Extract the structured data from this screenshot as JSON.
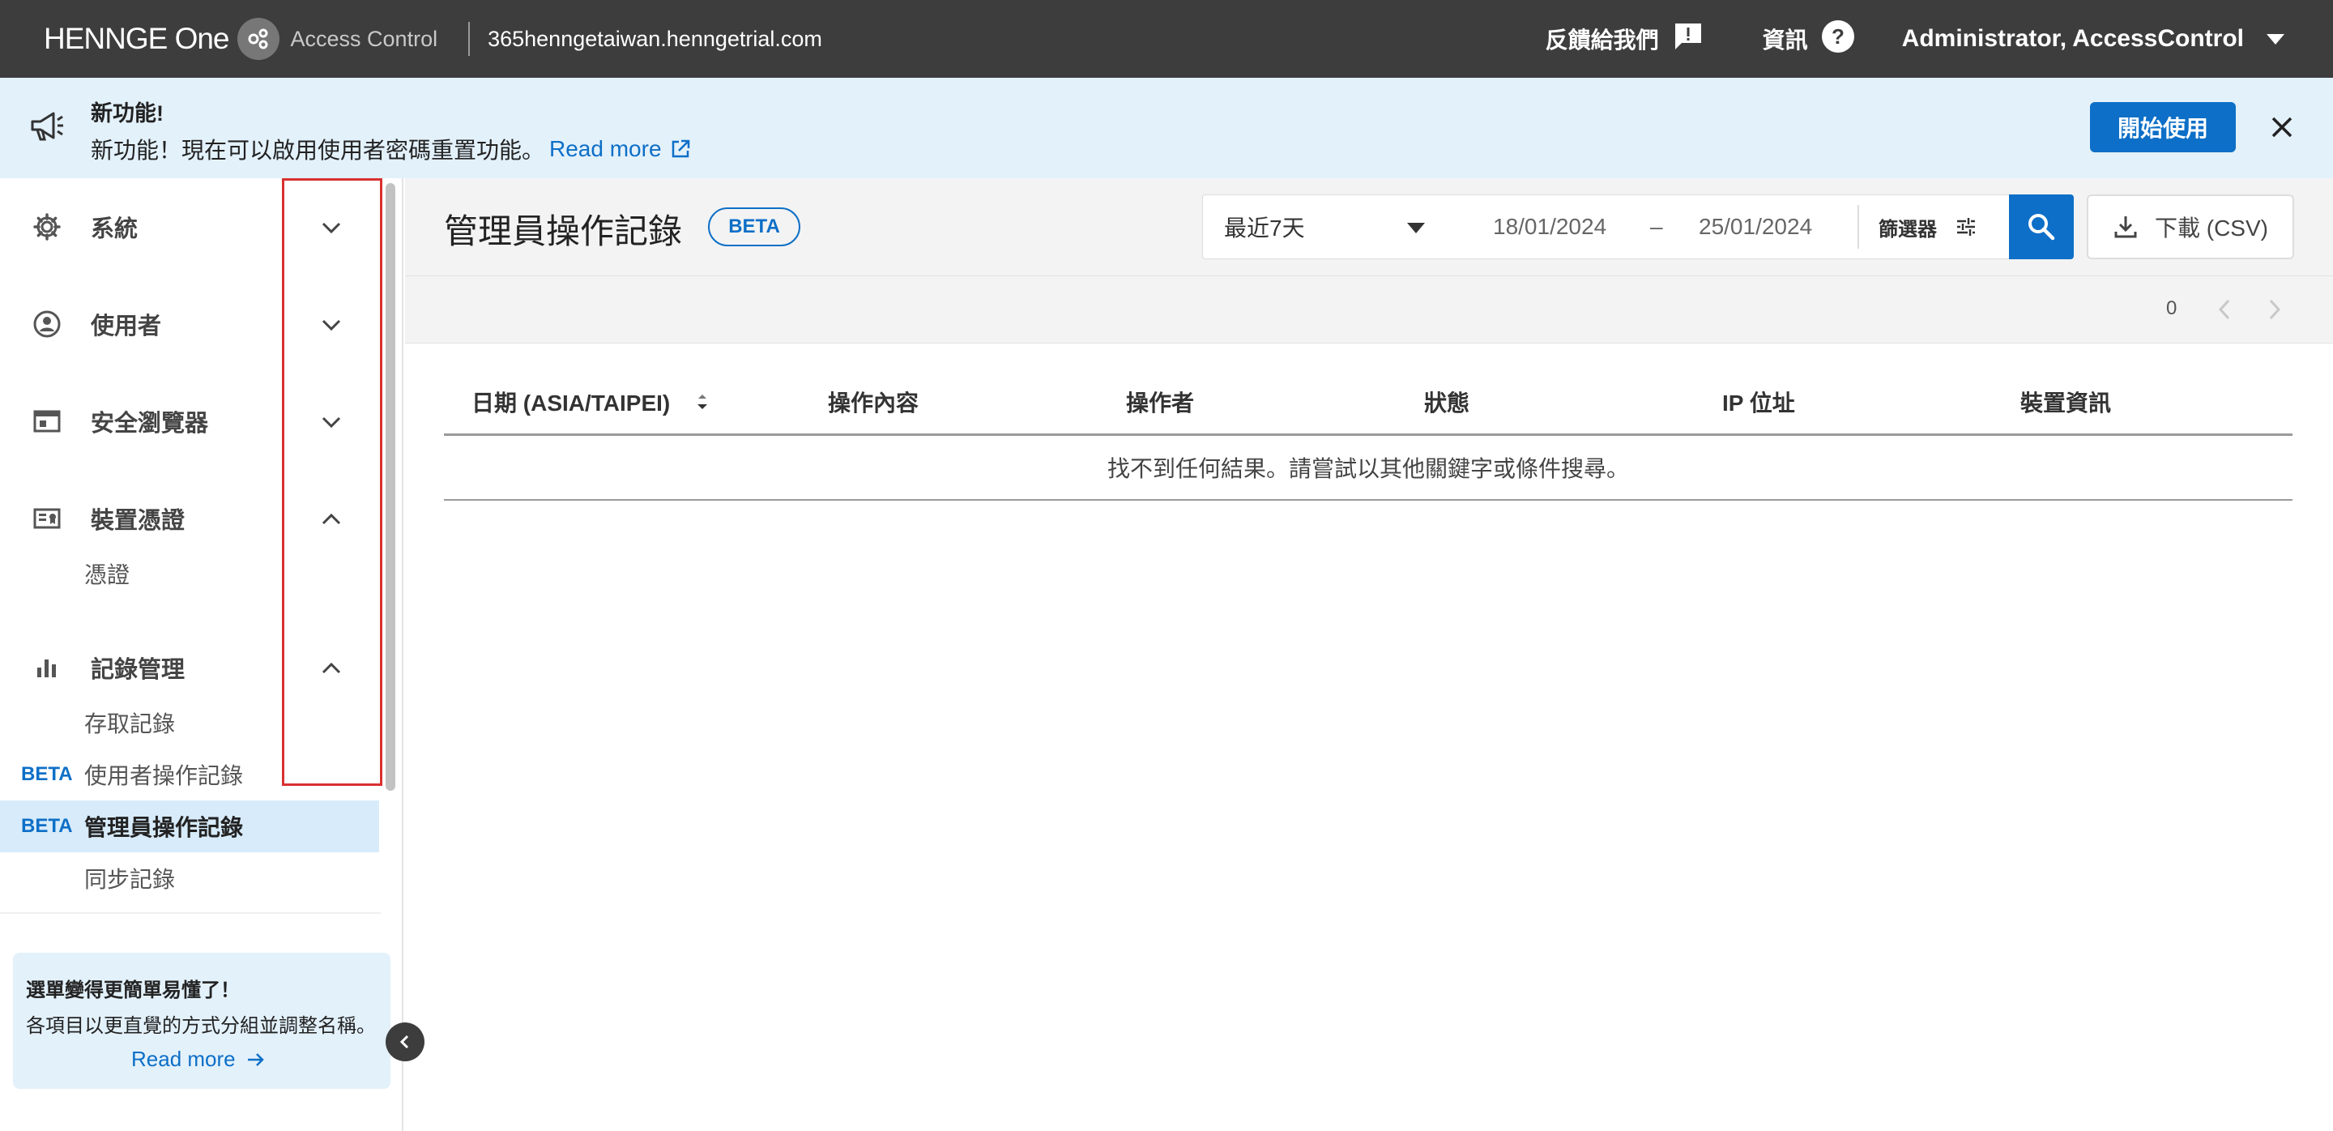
{
  "topbar": {
    "brand": "HENNGE One",
    "product": "Access Control",
    "tenant": "365henngetaiwan.henngetrial.com",
    "feedback_label": "反饋給我們",
    "info_label": "資訊",
    "user_label": "Administrator, AccessControl"
  },
  "banner": {
    "title": "新功能!",
    "text": "新功能！現在可以啟用使用者密碼重置功能。",
    "link": "Read more",
    "start_label": "開始使用"
  },
  "sidebar": {
    "groups": [
      {
        "label": "系統",
        "icon": "gear-icon",
        "expanded": false
      },
      {
        "label": "使用者",
        "icon": "user-icon",
        "expanded": false
      },
      {
        "label": "安全瀏覽器",
        "icon": "browser-icon",
        "expanded": false
      },
      {
        "label": "裝置憑證",
        "icon": "certificate-icon",
        "expanded": true
      },
      {
        "label": "記錄管理",
        "icon": "bar-chart-icon",
        "expanded": true
      }
    ],
    "items": [
      {
        "label": "憑證",
        "badge": ""
      },
      {
        "label": "存取記錄",
        "badge": ""
      },
      {
        "label": "使用者操作記錄",
        "badge": "BETA"
      },
      {
        "label": "管理員操作記錄",
        "badge": "BETA",
        "active": true
      },
      {
        "label": "同步記錄",
        "badge": ""
      }
    ],
    "promo": {
      "title": "選單變得更簡單易懂了！",
      "text": "各項目以更直覺的方式分組並調整名稱。",
      "link": "Read more"
    }
  },
  "main": {
    "title": "管理員操作記錄",
    "beta": "BETA",
    "range": "最近7天",
    "date_from": "18/01/2024",
    "date_sep": "–",
    "date_to": "25/01/2024",
    "filter_label": "篩選器",
    "csv_label": "下載 (CSV)",
    "count": "0",
    "columns": [
      "日期 (ASIA/TAIPEI)",
      "操作內容",
      "操作者",
      "狀態",
      "IP 位址",
      "裝置資訊"
    ],
    "empty_message": "找不到任何結果。請嘗試以其他關鍵字或條件搜尋。"
  },
  "colors": {
    "accent": "#0d6fc7",
    "topbar": "#3d3d3d",
    "banner": "#e3f1fb",
    "highlight_border": "#d93030"
  }
}
